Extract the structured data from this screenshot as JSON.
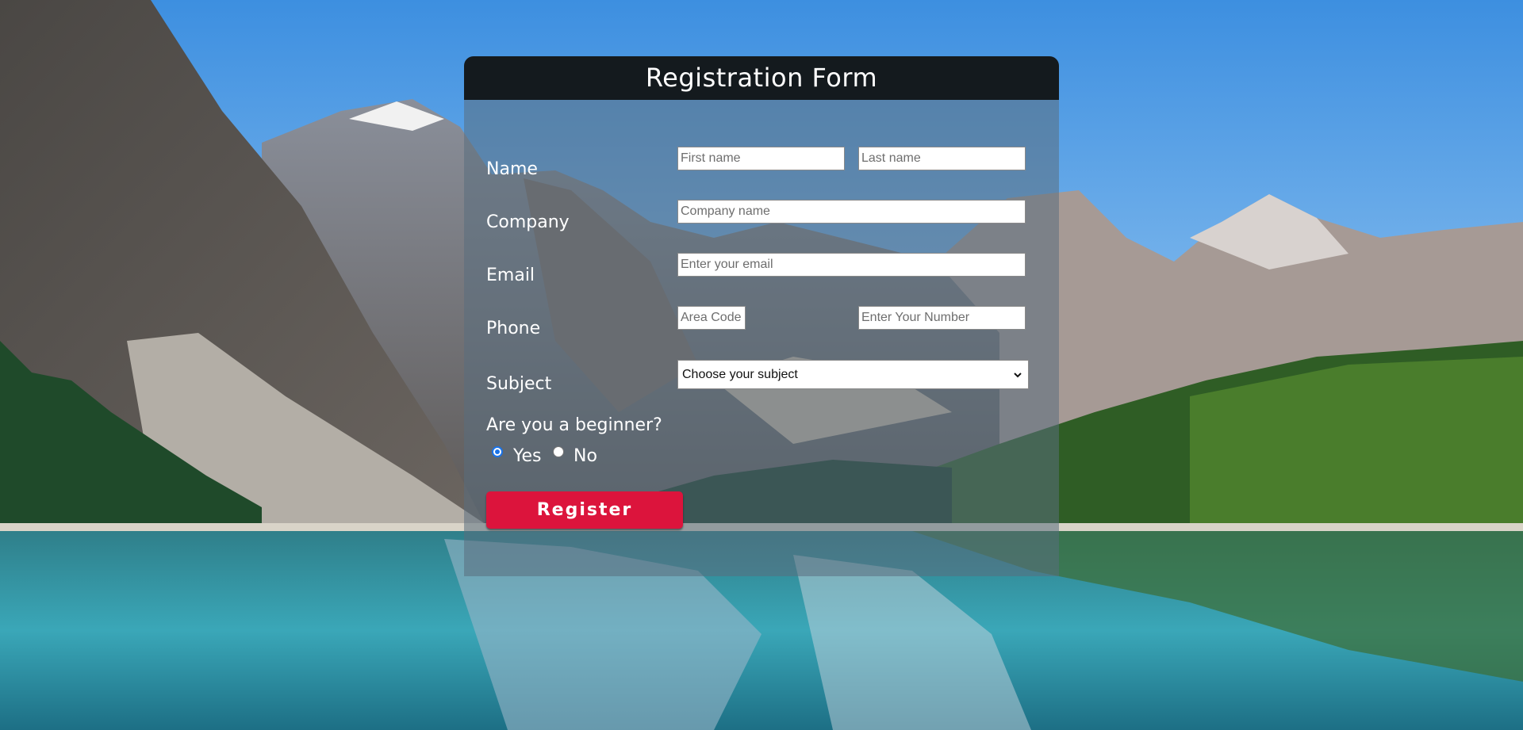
{
  "form": {
    "title": "Registration Form",
    "name_label": "Name",
    "first_name_placeholder": "First name",
    "last_name_placeholder": "Last name",
    "company_label": "Company",
    "company_placeholder": "Company name",
    "email_label": "Email",
    "email_placeholder": "Enter your email",
    "phone_label": "Phone",
    "area_code_placeholder": "Area Code",
    "number_placeholder": "Enter Your Number",
    "subject_label": "Subject",
    "subject_selected": "Choose your subject",
    "beginner_question": "Are you a beginner?",
    "yes_label": "Yes",
    "no_label": "No",
    "yes_checked": true,
    "register_label": "Register"
  },
  "colors": {
    "header_bg": "#141a1e",
    "button_bg": "#dc143c",
    "radio_accent": "#1a73e8"
  },
  "background": {
    "icon": "mountain-lake-landscape"
  }
}
